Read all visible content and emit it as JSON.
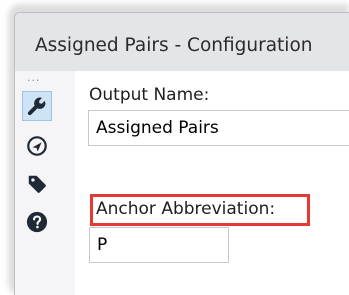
{
  "panel": {
    "title": "Assigned Pairs - Configuration"
  },
  "sidebar": {
    "drag_handle": "···",
    "tools": [
      {
        "icon": "wrench-icon",
        "selected": true
      },
      {
        "icon": "navigation-arrow-icon",
        "selected": false
      },
      {
        "icon": "tag-icon",
        "selected": false
      },
      {
        "icon": "help-icon",
        "selected": false
      }
    ]
  },
  "form": {
    "output_name_label": "Output Name:",
    "output_name_value": "Assigned Pairs",
    "anchor_abbreviation_label": "Anchor Abbreviation:",
    "anchor_abbreviation_value": "P"
  },
  "colors": {
    "title_bar": "#e3e5e8",
    "sidebar": "#f5f5f7",
    "selected_tool_fill": "#cfe3f6",
    "highlight_outline": "#e53935",
    "icon": "#1f2a36"
  }
}
